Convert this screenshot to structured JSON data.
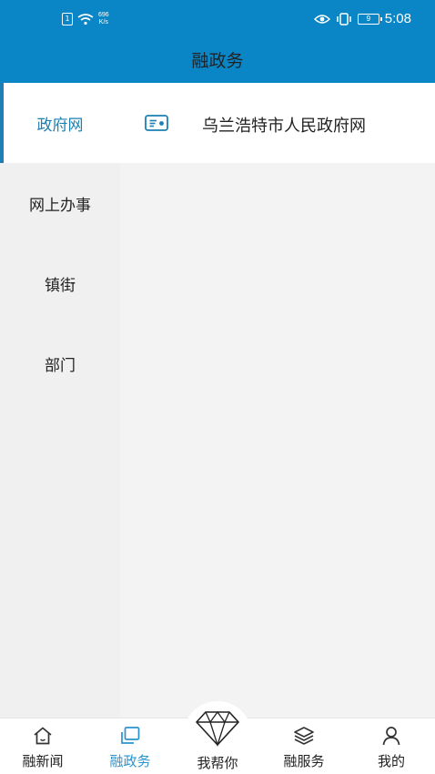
{
  "status_bar": {
    "speed": "696",
    "speed_unit": "K/s",
    "battery": "9",
    "time": "5:08"
  },
  "header": {
    "title": "融政务"
  },
  "sidebar": {
    "items": [
      {
        "label": "政府网",
        "active": true
      },
      {
        "label": "网上办事",
        "active": false
      },
      {
        "label": "镇街",
        "active": false
      },
      {
        "label": "部门",
        "active": false
      }
    ]
  },
  "content": {
    "items": [
      {
        "label": "乌兰浩特市人民政府网",
        "icon": "id-card-icon"
      }
    ]
  },
  "tab_bar": {
    "tabs": [
      {
        "label": "融新闻",
        "icon": "home-icon",
        "active": false
      },
      {
        "label": "融政务",
        "icon": "copy-icon",
        "active": true
      },
      {
        "label": "我帮你",
        "icon": "diamond-icon",
        "active": false
      },
      {
        "label": "融服务",
        "icon": "layers-icon",
        "active": false
      },
      {
        "label": "我的",
        "icon": "user-icon",
        "active": false
      }
    ]
  },
  "colors": {
    "header_bg": "#0a85c5",
    "accent": "#1d7fb4",
    "active_tab": "#2a93cf"
  }
}
